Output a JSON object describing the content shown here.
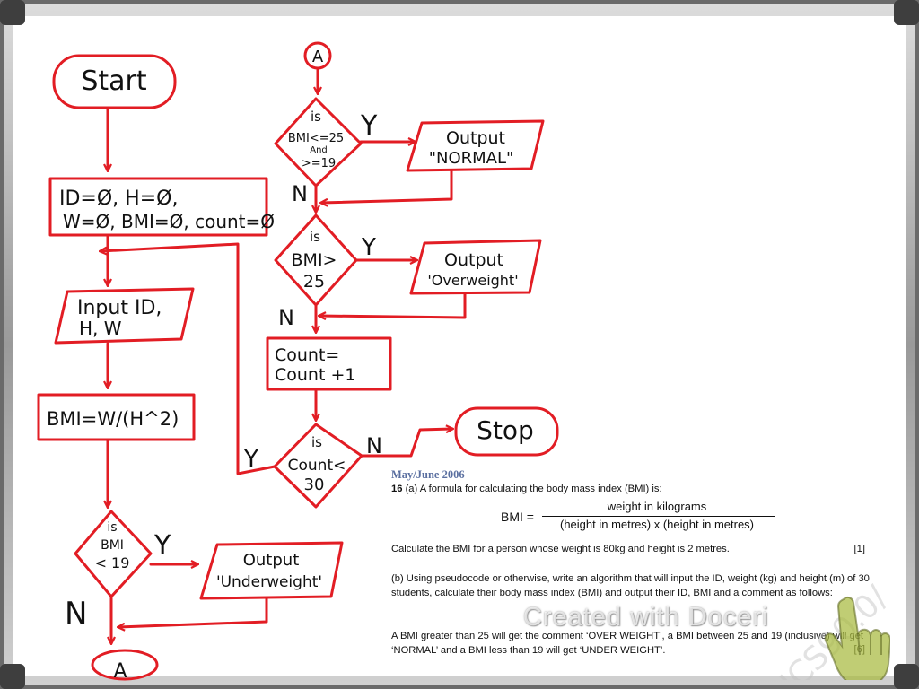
{
  "flowchart": {
    "start": "Start",
    "init_line1": "ID=Ø, H=Ø,",
    "init_line2": "W=Ø, BMI=Ø, count=Ø",
    "input_line1": "Input ID,",
    "input_line2": "H, W",
    "calc": "BMI=W/(H^2)",
    "dec_under_l1": "is",
    "dec_under_l2": "BMI",
    "dec_under_l3": "< 19",
    "out_under_l1": "Output",
    "out_under_l2": "'Underweight'",
    "connector": "A",
    "dec_normal_l1": "is",
    "dec_normal_l2": "BMI<=25",
    "dec_normal_l3": "And",
    "dec_normal_l4": ">=19",
    "out_normal_l1": "Output",
    "out_normal_l2": "\"NORMAL\"",
    "dec_over_l1": "is",
    "dec_over_l2": "BMI>",
    "dec_over_l3": "25",
    "out_over_l1": "Output",
    "out_over_l2": "'Overweight'",
    "count_l1": "Count=",
    "count_l2": "Count +1",
    "dec_count_l1": "is",
    "dec_count_l2": "Count<",
    "dec_count_l3": "30",
    "stop": "Stop",
    "yes": "Y",
    "no": "N"
  },
  "question": {
    "source": "May/June 2006",
    "number": "16",
    "part_a_intro": "(a) A formula for calculating the body mass index (BMI) is:",
    "formula_lhs": "BMI =",
    "formula_numerator": "weight in kilograms",
    "formula_denominator": "(height in metres)  x  (height in metres)",
    "calc_task": "Calculate the BMI for a person whose weight is 80kg and height is 2 metres.",
    "mark_a": "[1]",
    "part_b": "(b) Using pseudocode or otherwise, write an algorithm that will input the ID, weight (kg) and height (m) of 30 students, calculate their body mass index (BMI) and output their ID, BMI and a comment as follows:",
    "comment_rules": "A BMI greater than 25 will get the comment ‘OVER WEIGHT’, a BMI between 25 and 19 (inclusive) will get ‘NORMAL’ and a BMI less than 19 will get ‘UNDER WEIGHT’.",
    "mark_b": "[6]"
  },
  "watermark": {
    "text": "Created with Doceri",
    "scrawl": "ICS90.0/"
  },
  "colors": {
    "frame": "#6f6f6f",
    "board": "#ffffff",
    "red_ink": "#e21d24",
    "black_ink": "#111111",
    "source_blue": "#5a6fa0"
  }
}
